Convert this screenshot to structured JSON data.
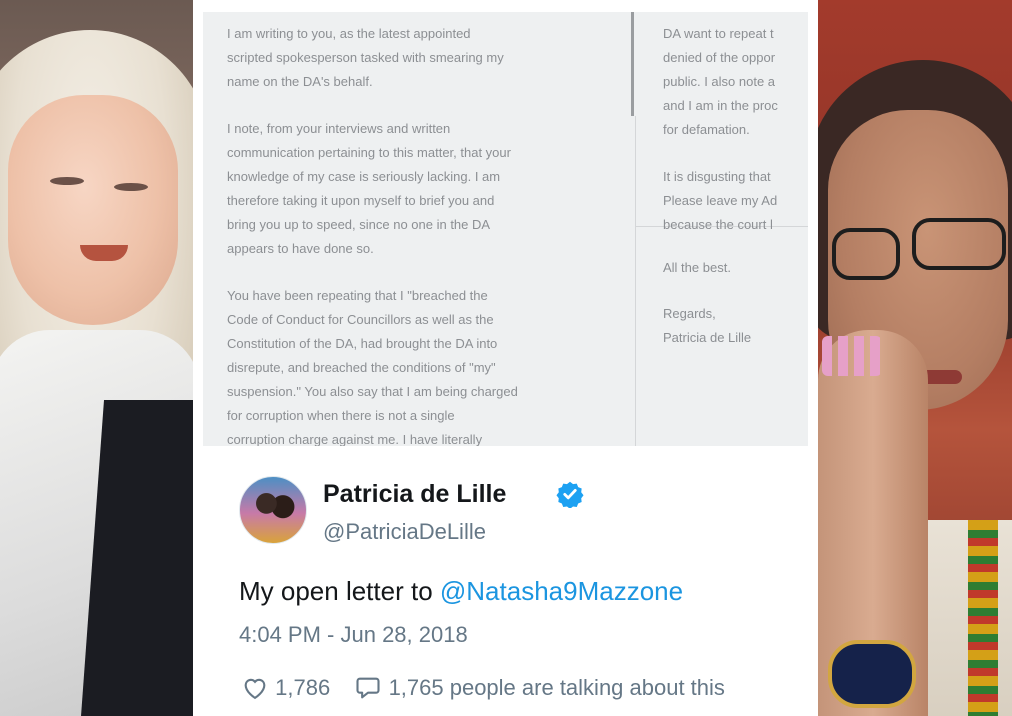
{
  "letter": {
    "col1_paragraphs": [
      "I am writing to you, as the latest appointed\nscripted spokesperson tasked with smearing my\nname on the DA's behalf.",
      "I note, from your interviews and written\ncommunication pertaining to this matter, that your\nknowledge of my case is seriously lacking. I am\ntherefore taking it upon myself to brief you and\nbring you up to speed, since no one in the DA\nappears to have done so.",
      "You have been repeating that I \"breached the\nCode of Conduct for Councillors as well as the\nConstitution of the DA, had brought the DA into\ndisrepute, and breached the conditions of \"my\"\nsuspension.\" You also say that I am being charged\nfor corruption when there is not a single\ncorruption charge against me. I have literally"
    ],
    "col2_paragraphs": [
      "DA want to repeat t\ndenied of the oppor\npublic. I also note a\nand I am in the proc\nfor defamation.",
      "It is disgusting that\nPlease leave my Ad\nbecause the court l"
    ],
    "closing": [
      "All the best.",
      "Regards,\nPatricia de Lille"
    ]
  },
  "tweet": {
    "name": "Patricia de Lille",
    "handle": "@PatriciaDeLille",
    "text_prefix": "My open letter to ",
    "mention": "@Natasha9Mazzone",
    "date": "4:04 PM - Jun 28, 2018",
    "likes": "1,786",
    "talking": "1,765 people are talking about this"
  },
  "colors": {
    "verified": "#1da1f2",
    "mention": "#1b95e0"
  }
}
